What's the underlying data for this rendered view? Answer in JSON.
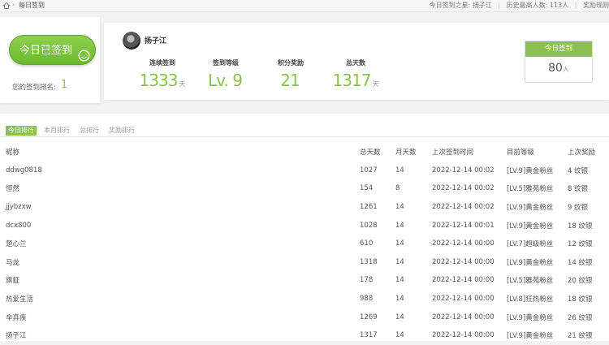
{
  "breadcrumb": {
    "separator": "›",
    "current": "每日签到"
  },
  "top_info": {
    "star_label": "今日签到之星:",
    "star_name": "扬子江",
    "record_label": "历史最高人数:",
    "record_value": "113人",
    "reward_rules": "奖励规则"
  },
  "sign_card": {
    "button_label": "今日已签到",
    "rank_label": "您的签到排名:",
    "rank_value": "1"
  },
  "user": {
    "name": "扬子江"
  },
  "stats": [
    {
      "label": "连续签到",
      "value": "1333",
      "unit": "天"
    },
    {
      "label": "签到等级",
      "value": "Lv. 9",
      "unit": ""
    },
    {
      "label": "积分奖励",
      "value": "21",
      "unit": ""
    },
    {
      "label": "总天数",
      "value": "1317",
      "unit": "天"
    }
  ],
  "today_box": {
    "title": "今日签到",
    "count": "80",
    "unit": "人"
  },
  "tabs": [
    "今日排行",
    "本月排行",
    "总排行",
    "奖励排行"
  ],
  "table": {
    "headers": [
      "昵称",
      "总天数",
      "月天数",
      "上次签到时间",
      "目前等级",
      "上次奖励"
    ],
    "rows": [
      [
        "ddwg0818",
        "1027",
        "14",
        "2022-12-14 00:02",
        "[LV.9]黄金粉丝",
        "4 纹银"
      ],
      [
        "恒然",
        "154",
        "8",
        "2022-12-14 00:02",
        "[LV.5]雅苑粉丝",
        "8 纹银"
      ],
      [
        "jjybzxw",
        "1261",
        "14",
        "2022-12-14 00:02",
        "[LV.9]黄金粉丝",
        "9 纹银"
      ],
      [
        "dcx800",
        "1028",
        "14",
        "2022-12-14 00:01",
        "[LV.9]黄金粉丝",
        "18 纹银"
      ],
      [
        "楚心兰",
        "610",
        "14",
        "2022-12-14 00:00",
        "[LV.7]超级粉丝",
        "12 纹银"
      ],
      [
        "马龙",
        "1318",
        "14",
        "2022-12-14 00:00",
        "[LV.9]黄金粉丝",
        "14 纹银"
      ],
      [
        "旗鉦",
        "178",
        "14",
        "2022-12-14 00:00",
        "[LV.5]雅苑粉丝",
        "20 纹银"
      ],
      [
        "热爱生活",
        "988",
        "14",
        "2022-12-14 00:00",
        "[LV.8]狂热粉丝",
        "18 纹银"
      ],
      [
        "辛弃疾",
        "1269",
        "14",
        "2022-12-14 00:00",
        "[LV.9]黄金粉丝",
        "26 纹银"
      ],
      [
        "扬子江",
        "1317",
        "14",
        "2022-12-14 00:00",
        "[LV.9]黄金粉丝",
        "21 纹银"
      ]
    ]
  },
  "icons": {
    "home": "home-icon",
    "smile": "smile-icon",
    "avatar": "avatar"
  },
  "colors": {
    "accent": "#8cc152"
  }
}
